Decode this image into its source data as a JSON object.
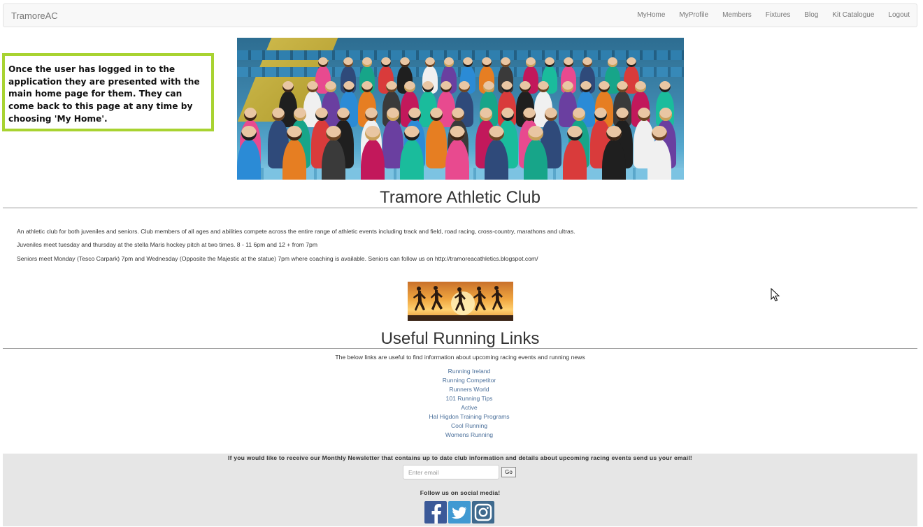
{
  "nav": {
    "brand": "TramoreAC",
    "items": [
      "MyHome",
      "MyProfile",
      "Members",
      "Fixtures",
      "Blog",
      "Kit Catalogue",
      "Logout"
    ]
  },
  "callout": {
    "text": "Once the user has logged in to the application they are presented with the main home page for them. They can come back to this page at any time by choosing 'My Home'."
  },
  "main": {
    "title": "Tramore Athletic Club",
    "paragraphs": [
      "An athletic club for both juveniles and seniors. Club members of all ages and abilities compete across the entire range of athletic events including track and field, road racing, cross-country, marathons and ultras.",
      "Juveniles meet tuesday and thursday at the stella Maris hockey pitch at two times. 8 - 11 6pm and 12 + from 7pm",
      "Seniors meet Monday (Tesco Carpark) 7pm and Wednesday (Opposite the Majestic at the statue) 7pm where coaching is available. Seniors can follow us on http://tramoreacathletics.blogspot.com/"
    ]
  },
  "links_section": {
    "title": "Useful Running Links",
    "intro": "The below links are useful to find information about upcoming racing events and running news",
    "links": [
      "Running Ireland",
      "Running Competitor",
      "Runners World",
      "101 Running Tips",
      "Active",
      "Hal Higdon Training Programs",
      "Cool Running",
      "Womens Running"
    ]
  },
  "footer": {
    "newsletter_text": "If you would like to receive our Monthly Newsletter that contains up to date club information and details about upcoming racing events send us your email!",
    "email_placeholder": "Enter email",
    "go_label": "Go",
    "follow_text": "Follow us on social media!",
    "social_icons": [
      "facebook-icon",
      "twitter-icon",
      "instagram-icon"
    ]
  },
  "colors": {
    "callout_border": "#a8d331",
    "link": "#4a6f9a",
    "footer_bg": "#e6e6e6",
    "facebook": "#3b5998",
    "twitter": "#4099d2",
    "instagram": "#3f6a8e"
  }
}
